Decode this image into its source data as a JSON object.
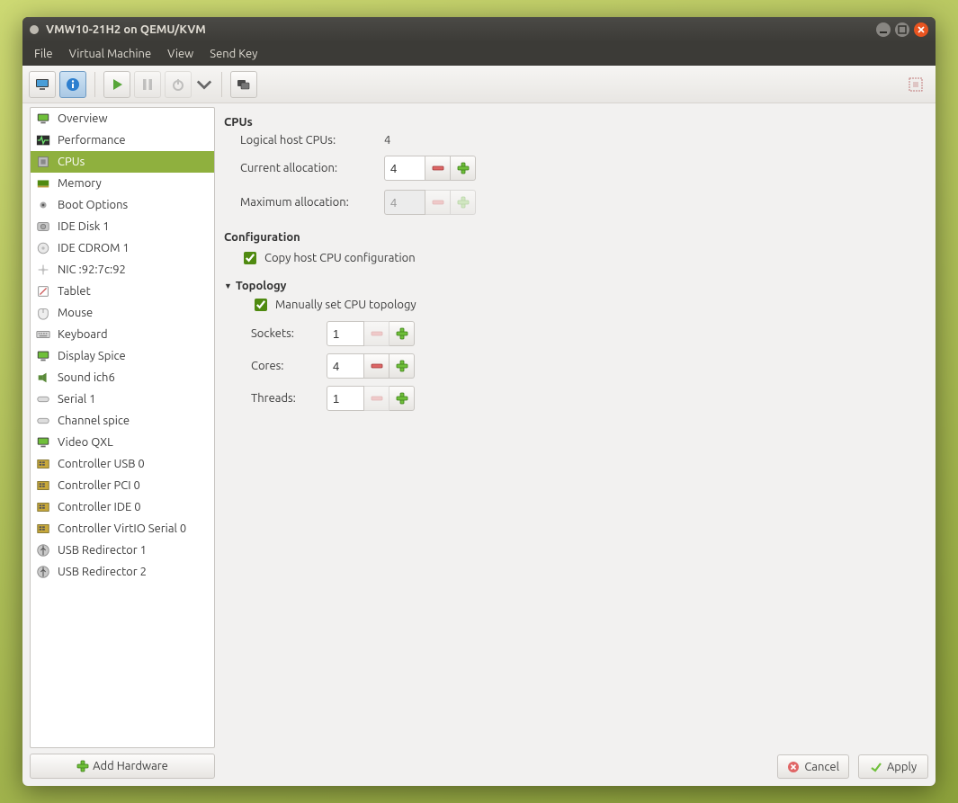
{
  "window": {
    "title": "VMW10-21H2 on QEMU/KVM"
  },
  "menubar": {
    "items": [
      "File",
      "Virtual Machine",
      "View",
      "Send Key"
    ]
  },
  "toolbar": {
    "console_icon": "console",
    "info_icon": "info",
    "play_icon": "play",
    "pause_icon": "pause",
    "power_icon": "power",
    "menu_icon": "dropdown",
    "screens_icon": "screens",
    "fullscreen_icon": "fullscreen"
  },
  "sidebar": {
    "items": [
      {
        "label": "Overview",
        "icon": "monitor"
      },
      {
        "label": "Performance",
        "icon": "pulse"
      },
      {
        "label": "CPUs",
        "icon": "cpu",
        "selected": true
      },
      {
        "label": "Memory",
        "icon": "ram"
      },
      {
        "label": "Boot Options",
        "icon": "gear"
      },
      {
        "label": "IDE Disk 1",
        "icon": "hdd"
      },
      {
        "label": "IDE CDROM 1",
        "icon": "cd"
      },
      {
        "label": "NIC :92:7c:92",
        "icon": "nic"
      },
      {
        "label": "Tablet",
        "icon": "tablet"
      },
      {
        "label": "Mouse",
        "icon": "mouse"
      },
      {
        "label": "Keyboard",
        "icon": "keyboard"
      },
      {
        "label": "Display Spice",
        "icon": "monitor"
      },
      {
        "label": "Sound ich6",
        "icon": "sound"
      },
      {
        "label": "Serial 1",
        "icon": "serial"
      },
      {
        "label": "Channel spice",
        "icon": "serial"
      },
      {
        "label": "Video QXL",
        "icon": "monitor"
      },
      {
        "label": "Controller USB 0",
        "icon": "ctrl"
      },
      {
        "label": "Controller PCI 0",
        "icon": "ctrl"
      },
      {
        "label": "Controller IDE 0",
        "icon": "ctrl"
      },
      {
        "label": "Controller VirtIO Serial 0",
        "icon": "ctrl"
      },
      {
        "label": "USB Redirector 1",
        "icon": "usb"
      },
      {
        "label": "USB Redirector 2",
        "icon": "usb"
      }
    ],
    "add_hardware_label": "Add Hardware"
  },
  "cpus": {
    "section_title": "CPUs",
    "logical_host_label": "Logical host CPUs:",
    "logical_host_value": "4",
    "current_alloc_label": "Current allocation:",
    "current_alloc_value": "4",
    "max_alloc_label": "Maximum allocation:",
    "max_alloc_value": "4"
  },
  "configuration": {
    "section_title": "Configuration",
    "copy_host_label": "Copy host CPU configuration",
    "copy_host_checked": true
  },
  "topology": {
    "section_title": "Topology",
    "manual_label": "Manually set CPU topology",
    "manual_checked": true,
    "sockets_label": "Sockets:",
    "sockets_value": "1",
    "cores_label": "Cores:",
    "cores_value": "4",
    "threads_label": "Threads:",
    "threads_value": "1"
  },
  "buttons": {
    "cancel": "Cancel",
    "apply": "Apply"
  }
}
